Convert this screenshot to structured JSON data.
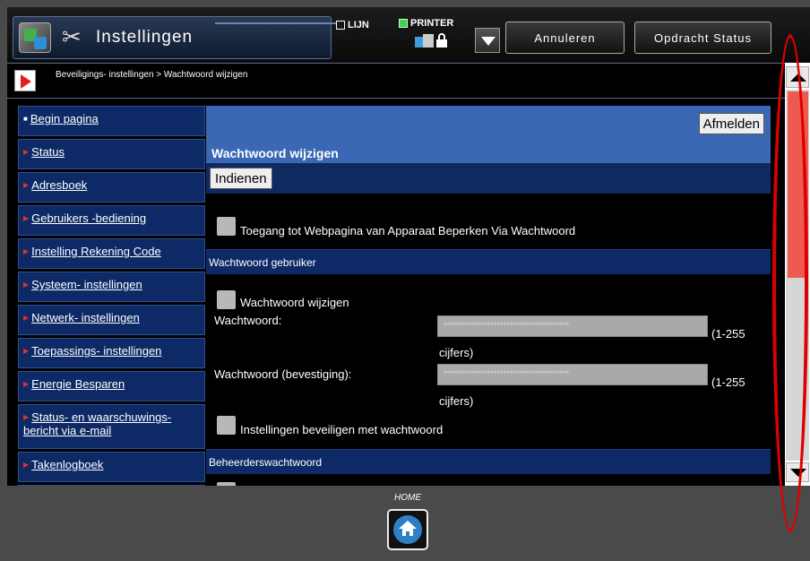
{
  "header": {
    "app_title": "Instellingen",
    "line_label": "LIJN",
    "printer_label": "PRINTER",
    "cancel_label": "Annuleren",
    "job_status_label": "Opdracht Status"
  },
  "breadcrumb": "Beveiligings- instellingen > Wachtwoord wijzigen",
  "sidebar": {
    "items": [
      {
        "label": "Begin pagina"
      },
      {
        "label": "Status"
      },
      {
        "label": "Adresboek"
      },
      {
        "label": "Gebruikers -bediening"
      },
      {
        "label": "Instelling Rekening Code"
      },
      {
        "label": "Systeem- instellingen"
      },
      {
        "label": "Netwerk- instellingen"
      },
      {
        "label": "Toepassings- instellingen"
      },
      {
        "label": "Energie Besparen"
      },
      {
        "label": "Status- en waarschuwings- bericht via e-mail"
      },
      {
        "label": "Takenlogboek"
      }
    ]
  },
  "content": {
    "logout_label": "Afmelden",
    "title": "Wachtwoord wijzigen",
    "submit_label": "Indienen",
    "restrict_access_label": "Toegang tot Webpagina van Apparaat Beperken Via Wachtwoord",
    "user_password_section": "Wachtwoord gebruiker",
    "change_password_label": "Wachtwoord wijzigen",
    "password_label": "Wachtwoord:",
    "password_value": "****************************************",
    "password_hint_a": "(1-255",
    "password_hint_b": "cijfers)",
    "confirm_label": "Wachtwoord (bevestiging):",
    "confirm_value": "****************************************",
    "confirm_hint_a": "(1-255",
    "confirm_hint_b": "cijfers)",
    "protect_settings_label": "Instellingen beveiligen met wachtwoord",
    "admin_password_section": "Beheerderswachtwoord"
  },
  "footer": {
    "home_label": "HOME"
  },
  "colors": {
    "accent": "#3a68b4",
    "sidebar_bg": "#0d2a66",
    "scroll_thumb": "#ef5a50",
    "annotation": "#dd0000"
  }
}
